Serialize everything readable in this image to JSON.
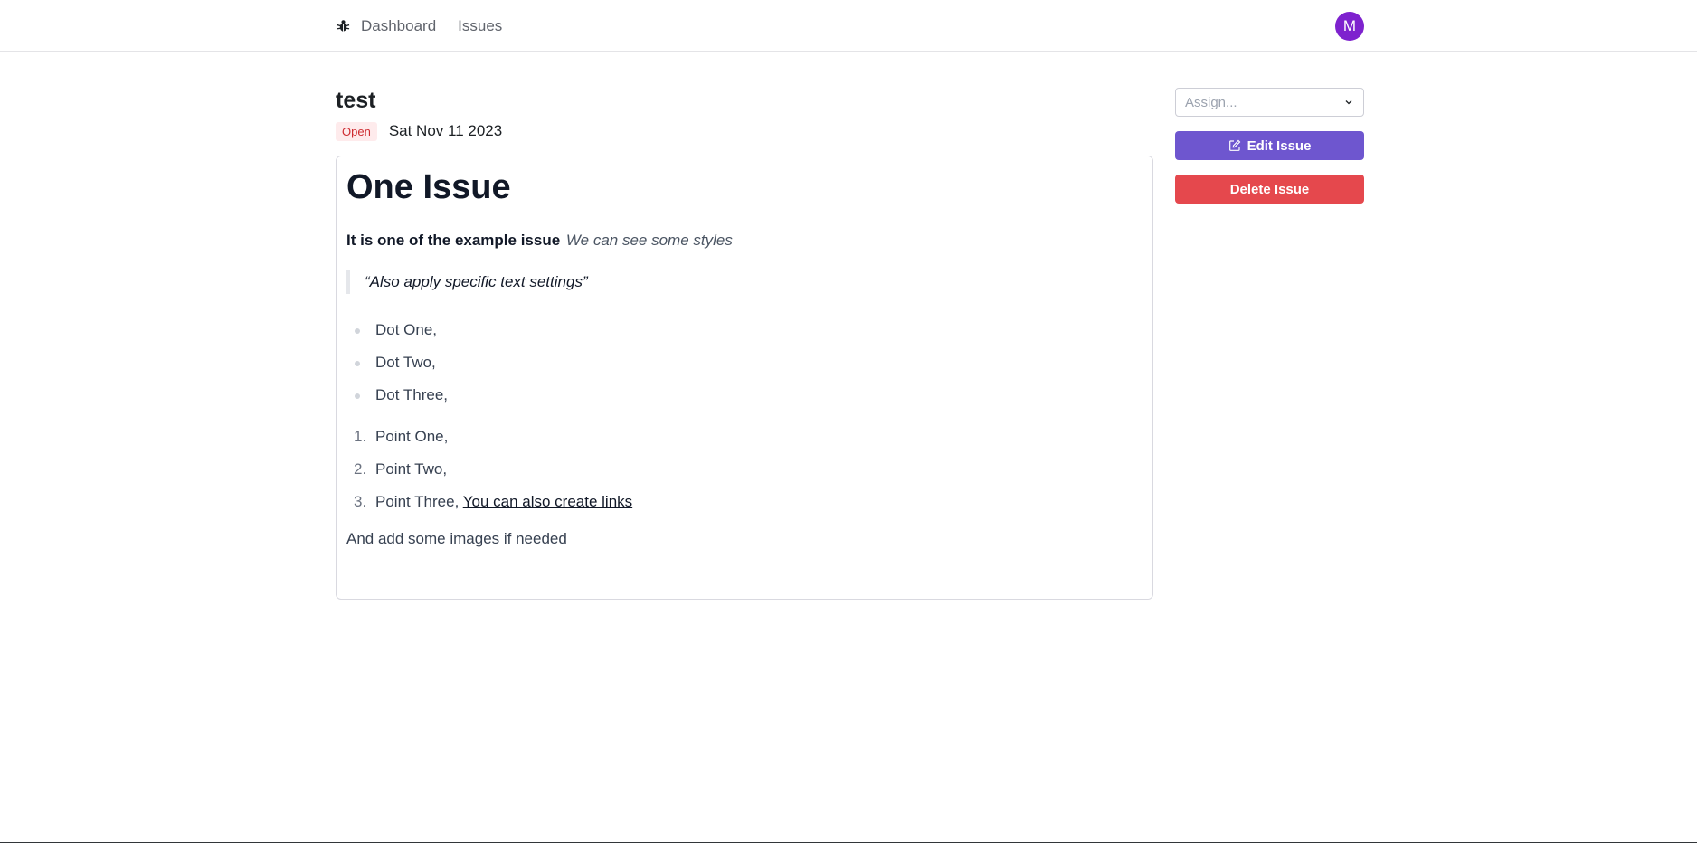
{
  "nav": {
    "logo_icon": "bug-icon",
    "links": [
      "Dashboard",
      "Issues"
    ],
    "avatar_initial": "M",
    "avatar_color": "#7e22ce"
  },
  "issue": {
    "title": "test",
    "status": "Open",
    "date": "Sat Nov 11 2023",
    "description": {
      "heading": "One Issue",
      "bold_text": "It is one of the example issue",
      "italic_text": "We can see some styles",
      "quote": "“Also apply specific text settings”",
      "bullets": [
        "Dot One,",
        "Dot Two,",
        "Dot Three,"
      ],
      "numbered": [
        {
          "num": "1.",
          "text": "Point One,"
        },
        {
          "num": "2.",
          "text": "Point Two,"
        },
        {
          "num": "3.",
          "text": "Point Three,"
        }
      ],
      "link_text": "You can also create links",
      "closing": "And add some images if needed"
    }
  },
  "sidebar": {
    "assign_placeholder": "Assign...",
    "edit_label": "Edit Issue",
    "delete_label": "Delete Issue",
    "edit_color": "#6e56cf",
    "delete_color": "#e5484d"
  }
}
